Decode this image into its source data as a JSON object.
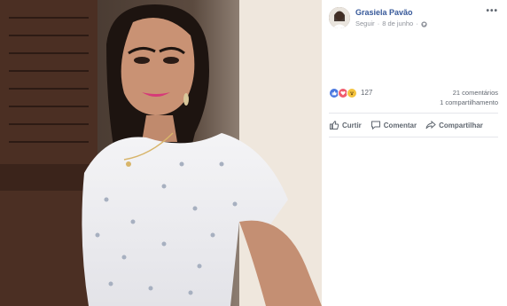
{
  "post": {
    "author_name": "Grasiela Pavão",
    "follow_label": "Seguir",
    "separator": "·",
    "date": "8 de junho",
    "more_label": "•••"
  },
  "reactions": {
    "icons": [
      "like-icon",
      "love-icon",
      "wow-icon"
    ],
    "count": "127",
    "colors": {
      "like": "#4a78e0",
      "love": "#f05b6d",
      "wow": "#f4c33d"
    }
  },
  "stats": {
    "comments": "21 comentários",
    "shares": "1 compartilhamento"
  },
  "actions": {
    "like_label": "Curtir",
    "comment_label": "Comentar",
    "share_label": "Compartilhar"
  }
}
